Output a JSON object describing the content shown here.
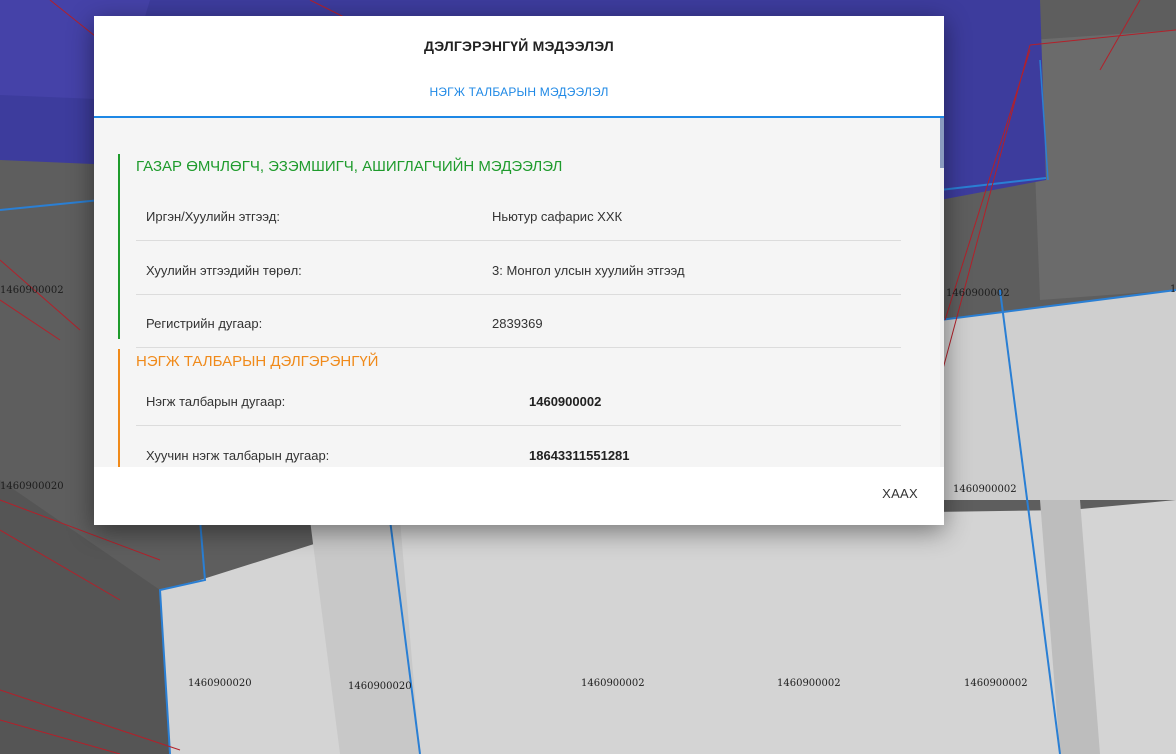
{
  "map": {
    "parcel_labels": [
      "1460900002",
      "1460900020",
      "1460900002",
      "1460900002",
      "1460900020",
      "1460900020",
      "1460900002",
      "1460900002",
      "1460900002",
      "1"
    ]
  },
  "dialog": {
    "title": "ДЭЛГЭРЭНГҮЙ МЭДЭЭЛЭЛ",
    "tab": "НЭГЖ ТАЛБАРЫН МЭДЭЭЛЭЛ",
    "owner_section": {
      "title": "ГАЗАР ӨМЧЛӨГЧ, ЭЗЭМШИГЧ, АШИГЛАГЧИЙН МЭДЭЭЛЭЛ",
      "rows": [
        {
          "label": "Иргэн/Хуулийн этгээд:",
          "value": "Ньютур сафарис ХХК"
        },
        {
          "label": "Хуулийн этгээдийн төрөл:",
          "value": "3: Монгол улсын хуулийн этгээд"
        },
        {
          "label": "Регистрийн дугаар:",
          "value": "2839369"
        }
      ]
    },
    "parcel_section": {
      "title": "НЭГЖ ТАЛБАРЫН ДЭЛГЭРЭНГҮЙ",
      "rows": [
        {
          "label": "Нэгж талбарын дугаар:",
          "value": "1460900002"
        },
        {
          "label": "Хуучин нэгж талбарын дугаар:",
          "value": "18643311551281"
        }
      ]
    },
    "close_label": "ХААХ"
  },
  "colors": {
    "accent": "#1e88e5",
    "owner_green": "#1e9b2c",
    "parcel_orange": "#f08a1a"
  }
}
